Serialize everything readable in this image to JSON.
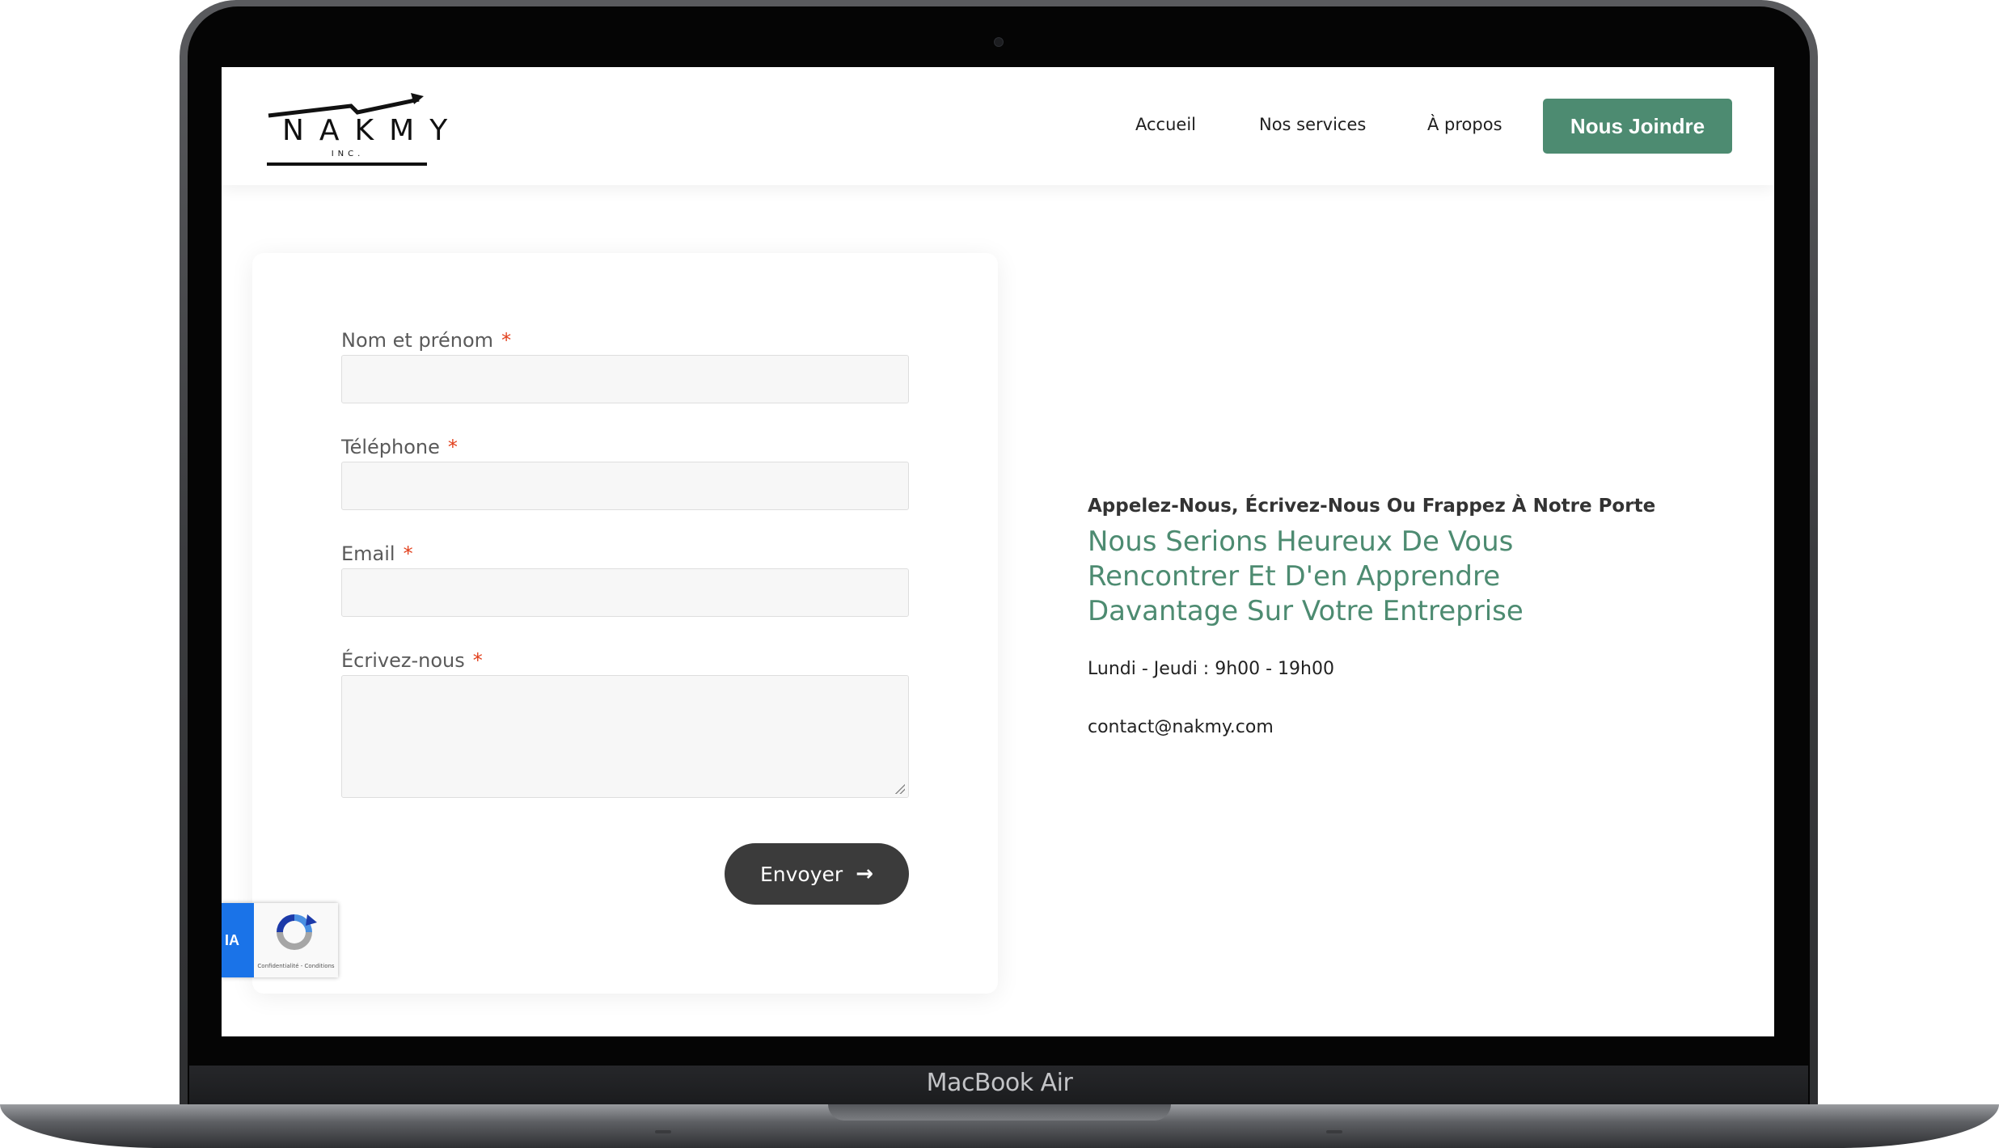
{
  "device": {
    "label": "MacBook Air"
  },
  "header": {
    "logo": {
      "name": "NAKMY",
      "sub": "INC."
    },
    "nav": [
      {
        "label": "Accueil"
      },
      {
        "label": "Nos services"
      },
      {
        "label": "À propos"
      }
    ],
    "cta_label": "Nous Joindre",
    "accent_color": "#4d8b71"
  },
  "form": {
    "fields": [
      {
        "label": "Nom et prénom",
        "required_mark": "*",
        "value": ""
      },
      {
        "label": "Téléphone",
        "required_mark": "*",
        "value": ""
      },
      {
        "label": "Email",
        "required_mark": "*",
        "value": ""
      },
      {
        "label": "Écrivez-nous",
        "required_mark": "*",
        "value": ""
      }
    ],
    "submit_label": "Envoyer",
    "submit_icon": "arrow-right-icon"
  },
  "recaptcha": {
    "tab_text": "IA",
    "links": "Confidentialité - Conditions"
  },
  "contact": {
    "kicker": "Appelez-Nous, Écrivez-Nous Ou Frappez À Notre Porte",
    "heading_lines": [
      "Nous Serions Heureux De Vous",
      "Rencontrer Et D'en Apprendre",
      "Davantage Sur Votre Entreprise"
    ],
    "hours": "Lundi - Jeudi : 9h00 - 19h00",
    "email": "contact@nakmy.com"
  }
}
